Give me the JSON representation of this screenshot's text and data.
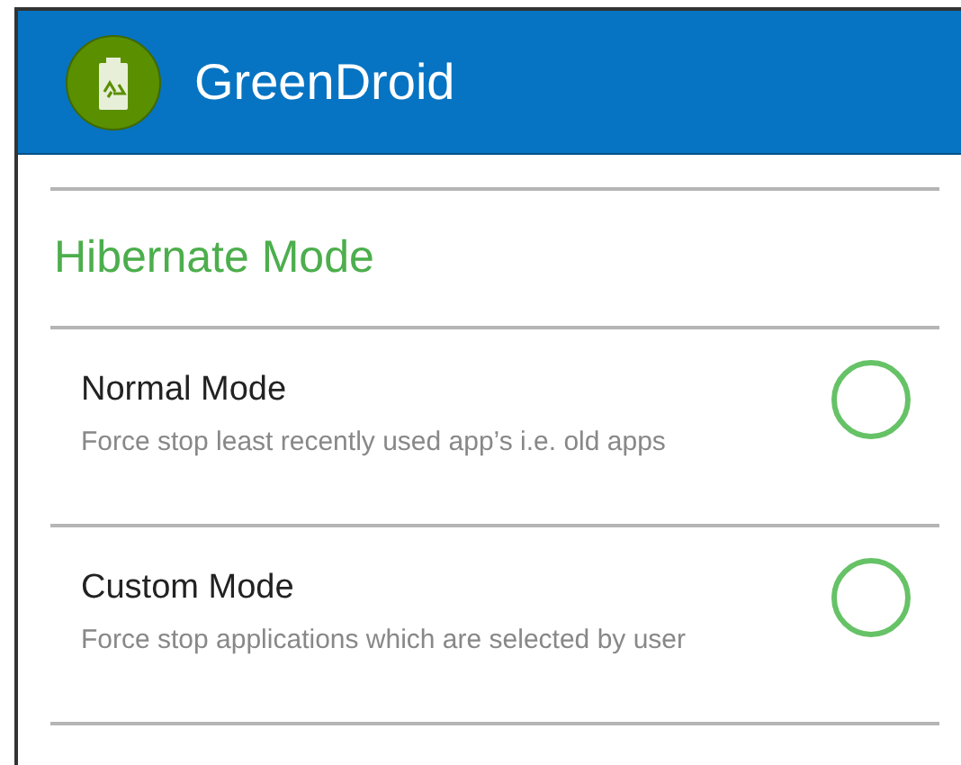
{
  "app_bar": {
    "title": "GreenDroid"
  },
  "section": {
    "title": "Hibernate Mode"
  },
  "options": [
    {
      "title": "Normal Mode",
      "description": "Force stop least recently used app’s i.e. old apps",
      "selected": false
    },
    {
      "title": "Custom Mode",
      "description": "Force stop applications which are selected by user",
      "selected": false
    }
  ]
}
